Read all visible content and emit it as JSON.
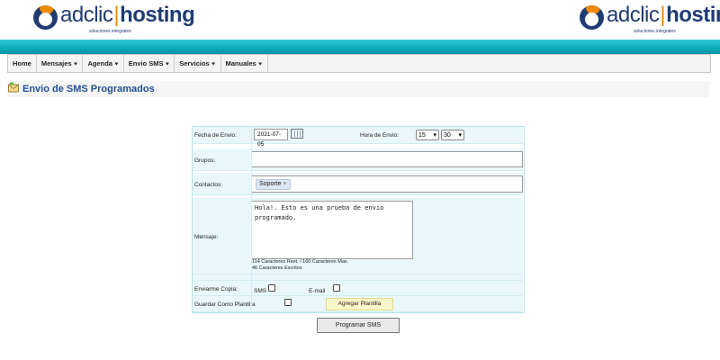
{
  "logo": {
    "brand_left": "adclic",
    "brand_right": "hosting",
    "tagline": "soluciones integrales"
  },
  "nav": [
    "Home",
    "Mensajes",
    "Agenda",
    "Envio SMS",
    "Servicios",
    "Manuales"
  ],
  "nav_chevron": "⯆",
  "page_title": "Envio de SMS Programados",
  "form": {
    "fecha_label": "Fecha de Envio:",
    "fecha_value": "2021-07-05",
    "hora_label": "Hora de Envio:",
    "hora_value": "15",
    "minuto_value": "30",
    "grupos_label": "Grupos:",
    "grupos_value": "",
    "contactos_label": "Contactos:",
    "contact_tag": "Soporte",
    "contact_tag_remove": "×",
    "mensaje_label": "Mensaje:",
    "mensaje_value": "Hola!. Esto es una prueba de envio programado.",
    "counter_line1": "114 Caracteres Rest. / 160 Caracteres Max.",
    "counter_line2": "46 Caracteres Escritos",
    "enviarme_label": "Enviarme Copia:",
    "sms_label": "SMS",
    "email_label": "E-mail",
    "plantilla_label": "Guardar Como Plantilla",
    "agregar_plantilla": "Agregar Plantilla",
    "programar": "Programar SMS"
  },
  "icons": {
    "title": "sms-envelope-icon",
    "calendar": "calendar-icon",
    "dropdown": "chevron-down-icon"
  }
}
